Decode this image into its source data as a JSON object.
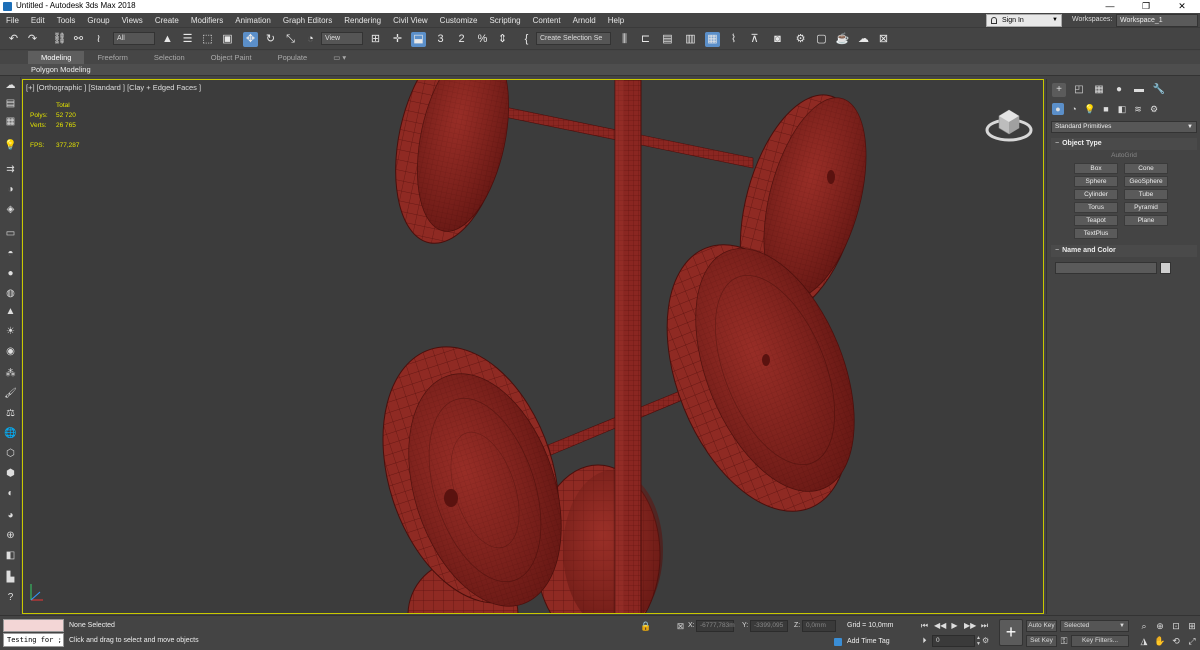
{
  "window": {
    "title": "Untitled - Autodesk 3ds Max 2018",
    "minimize": "—",
    "maximize": "❐",
    "close": "✕"
  },
  "menu": {
    "items": [
      "File",
      "Edit",
      "Tools",
      "Group",
      "Views",
      "Create",
      "Modifiers",
      "Animation",
      "Graph Editors",
      "Rendering",
      "Civil View",
      "Customize",
      "Scripting",
      "Content",
      "Arnold",
      "Help"
    ],
    "sign_in": "Sign In",
    "workspaces_label": "Workspaces:",
    "workspace_value": "Workspace_1"
  },
  "toolbar": {
    "selection_filter": "All",
    "reference_coord": "View",
    "named_selection_set": "Create Selection Se",
    "snap_toggle_label": "3",
    "angle_snap_label": "2",
    "percent_snap_label": "%"
  },
  "ribbon": {
    "tabs": [
      "Modeling",
      "Freeform",
      "Selection",
      "Object Paint",
      "Populate"
    ],
    "active_tab": "Modeling",
    "sub_label": "Polygon Modeling"
  },
  "viewport": {
    "label": "[+] [Orthographic ] [Standard ] [Clay + Edged Faces ]",
    "stats": {
      "header": "Total",
      "polys_label": "Polys:",
      "polys_value": "52 720",
      "verts_label": "Verts:",
      "verts_value": "26 765",
      "fps_label": "FPS:",
      "fps_value": "377,287"
    },
    "object_color": "#8f2a23",
    "border_color": "#c8c800"
  },
  "command_panel": {
    "category": "Standard Primitives",
    "object_type_title": "Object Type",
    "autogrid": "AutoGrid",
    "primitives": [
      "Box",
      "Cone",
      "Sphere",
      "GeoSphere",
      "Cylinder",
      "Tube",
      "Torus",
      "Pyramid",
      "Teapot",
      "Plane",
      "TextPlus"
    ],
    "name_color_title": "Name and Color"
  },
  "status": {
    "listener_text": "Testing for ;",
    "selection": "None Selected",
    "prompt": "Click and drag to select and move objects",
    "x_label": "X:",
    "x_value": "-6777,783m",
    "y_label": "Y:",
    "y_value": "-3399,095",
    "z_label": "Z:",
    "z_value": "0,0mm",
    "grid": "Grid = 10,0mm",
    "add_time_tag": "Add Time Tag",
    "frame_value": "0",
    "auto_key": "Auto Key",
    "set_key": "Set Key",
    "key_mode": "Selected",
    "key_filters": "Key Filters..."
  }
}
